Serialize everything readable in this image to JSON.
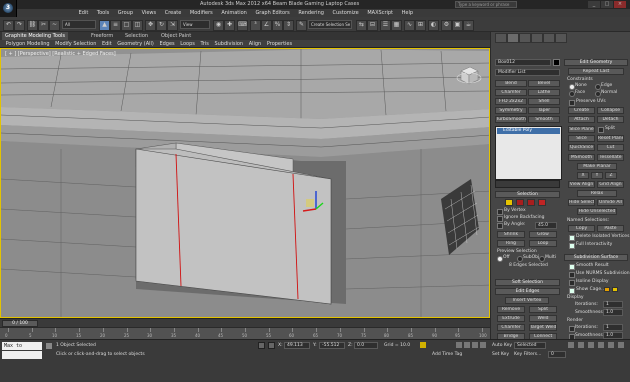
{
  "window": {
    "title": "Autodesk 3ds Max 2012 x64    Beam Blade Gaming Laptop Cases",
    "search_placeholder": "Type a keyword or phrase",
    "controls": [
      "_",
      "□",
      "×"
    ]
  },
  "menubar": [
    "Edit",
    "Tools",
    "Group",
    "Views",
    "Create",
    "Modifiers",
    "Animation",
    "Graph Editors",
    "Rendering",
    "Customize",
    "MAXScript",
    "Help"
  ],
  "toolbar": {
    "selection_filter": "All",
    "ref_coord": "View",
    "named_set": "Create Selection Se"
  },
  "ribbon": {
    "tabs": [
      "Graphite Modeling Tools",
      "Freeform",
      "Selection",
      "Object Paint"
    ],
    "active_tab": "Graphite Modeling Tools",
    "subtabs": [
      "Polygon Modeling",
      "Modify Selection",
      "Edit",
      "Geometry (All)",
      "Edges",
      "Loops",
      "Tris",
      "Subdivision",
      "Align",
      "Properties"
    ]
  },
  "viewport": {
    "label": "[ + ] [Perspective] [Realistic + Edged Faces]",
    "viewcube_label": "FRONT"
  },
  "command_panel": {
    "object_name": "Box012",
    "modifier_list": "Modifier List",
    "modifier_buttons": [
      "Bend",
      "Bevel",
      "Chamfer",
      "Lathe",
      "FFD 2x2x2",
      "Shell",
      "Symmetry",
      "Taper",
      "TurboSmooth",
      "Smooth"
    ],
    "stack_item": "Editable Poly",
    "selection": {
      "header": "Selection",
      "by_vertex": "By Vertex",
      "ignore_backfacing": "Ignore Backfacing",
      "by_angle": "By Angle:",
      "angle": "45.0",
      "shrink": "Shrink",
      "grow": "Grow",
      "ring": "Ring",
      "loop": "Loop",
      "preview_selection": "Preview Selection",
      "preview_options": [
        "Off",
        "SubObj",
        "Multi"
      ],
      "status": "8 Edges Selected"
    },
    "soft_selection": {
      "header": "Soft Selection"
    },
    "edit_edges": {
      "header": "Edit Edges",
      "insert_vertex": "Insert Vertex",
      "remove": "Remove",
      "split": "Split",
      "extrude": "Extrude",
      "weld": "Weld",
      "chamfer": "Chamfer",
      "target_weld": "Target Weld",
      "bridge": "Bridge",
      "connect": "Connect",
      "create_shape": "Create Shape From Selection",
      "weight_label": "Weight:",
      "weight": "1.0",
      "crease_label": "Crease:",
      "crease": "0.0"
    },
    "edit_geometry": {
      "header": "Edit Geometry",
      "repeat_last": "Repeat Last",
      "constraints": "Constraints",
      "constraint_options": [
        "None",
        "Edge",
        "Face",
        "Normal"
      ],
      "preserve_uvs": "Preserve UVs",
      "create": "Create",
      "collapse": "Collapse",
      "attach": "Attach",
      "detach": "Detach",
      "slice_plane": "Slice Plane",
      "split": "Split",
      "slice": "Slice",
      "reset_plane": "Reset Plane",
      "quickslice": "QuickSlice",
      "cut": "Cut",
      "msmooth": "MSmooth",
      "tessellate": "Tessellate",
      "make_planar": "Make Planar",
      "xyz": [
        "X",
        "Y",
        "Z"
      ],
      "view_align": "View Align",
      "grid_align": "Grid Align",
      "relax": "Relax",
      "hide_selected": "Hide Selected",
      "unhide_all": "Unhide All",
      "hide_unselected": "Hide Unselected",
      "named_selections": "Named Selections:",
      "copy": "Copy",
      "paste": "Paste",
      "delete_isolated": "Delete Isolated Vertices",
      "full_interactivity": "Full Interactivity"
    },
    "subdivision_surface": {
      "header": "Subdivision Surface",
      "smooth_result": "Smooth Result",
      "use_nurms": "Use NURMS Subdivision",
      "isoline_display": "Isoline Display",
      "show_cage": "Show Cage......",
      "display": "Display",
      "iterations_label": "Iterations:",
      "iterations": "1",
      "smoothness_label": "Smoothness:",
      "smoothness": "1.0",
      "render": "Render",
      "separate_by": "Separate By",
      "smoothing_groups": "Smoothing Groups",
      "materials": "Materials",
      "update_options": "Update Options",
      "always": "Always",
      "when_rendering": "When Rendering",
      "manually": "Manually"
    }
  },
  "timeline": {
    "frame_display": "0 / 100",
    "ticks": [
      "0",
      "5",
      "10",
      "15",
      "20",
      "25",
      "30",
      "35",
      "40",
      "45",
      "50",
      "55",
      "60",
      "65",
      "70",
      "75",
      "80",
      "85",
      "90",
      "95",
      "100"
    ]
  },
  "status": {
    "script_listener": "Max to Physc.",
    "selected": "1 Object Selected",
    "prompt": "Click or click-and-drag to select objects",
    "x_label": "X:",
    "x": "49.113",
    "y_label": "Y:",
    "y": "-55.512",
    "z_label": "Z:",
    "z": "0.0",
    "grid": "Grid = 10.0",
    "add_time_tag": "Add Time Tag",
    "auto_key": "Auto Key",
    "set_key": "Set Key",
    "key_mode": "Selected",
    "key_filters": "Key Filters...",
    "frame": "0"
  }
}
